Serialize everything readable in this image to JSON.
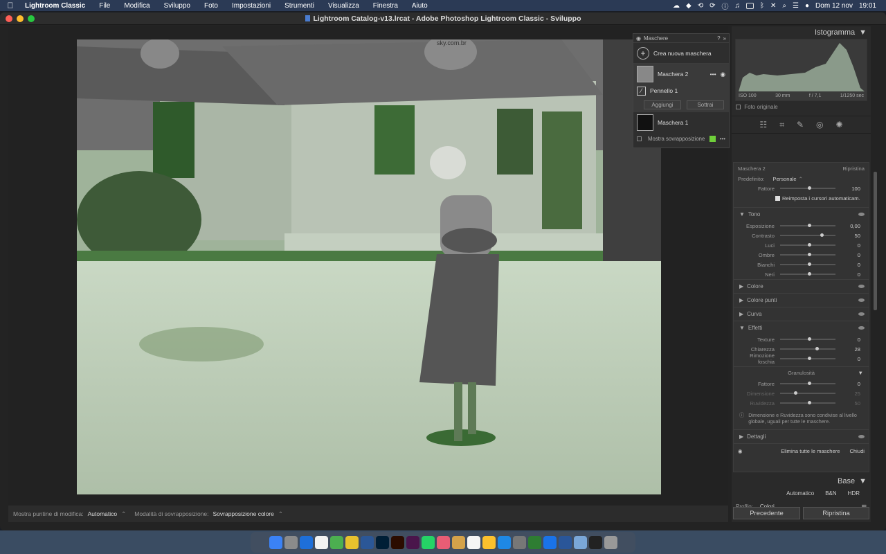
{
  "menubar": {
    "app": "Lightroom Classic",
    "items": [
      "File",
      "Modifica",
      "Sviluppo",
      "Foto",
      "Impostazioni",
      "Strumenti",
      "Visualizza",
      "Finestra",
      "Aiuto"
    ],
    "date": "Dom 12 nov",
    "time": "19:01"
  },
  "window": {
    "title": "Lightroom Catalog-v13.lrcat - Adobe Photoshop Lightroom Classic - Sviluppo"
  },
  "photo_overlay": {
    "color": "#7ed36a"
  },
  "masks_panel": {
    "title": "Maschere",
    "create_label": "Crea nuova maschera",
    "mask2": "Maschera 2",
    "brush": "Pennello 1",
    "add": "Aggiungi",
    "subtract": "Sottrai",
    "mask1": "Maschera 1",
    "show_overlay": "Mostra sovrapposizione",
    "overlay_color": "#6fcf3a"
  },
  "histogram": {
    "title": "Istogramma",
    "iso": "ISO 100",
    "focal": "30 mm",
    "aperture": "f / 7,1",
    "shutter": "1/1250 sec",
    "original_photo": "Foto originale"
  },
  "mask_settings": {
    "mask_name": "Maschera 2",
    "reset": "Ripristina",
    "preset_label": "Predefinito:",
    "preset_value": "Personale",
    "amount_label": "Fattore",
    "amount_value": "100",
    "auto_reset": "Reimposta i cursori automaticam.",
    "tone_header": "Tono",
    "tone": [
      {
        "label": "Esposizione",
        "value": "0,00",
        "pos": 0.5
      },
      {
        "label": "Contrasto",
        "value": "50",
        "pos": 0.72
      },
      {
        "label": "Luci",
        "value": "0",
        "pos": 0.5
      },
      {
        "label": "Ombre",
        "value": "0",
        "pos": 0.5
      },
      {
        "label": "Bianchi",
        "value": "0",
        "pos": 0.5
      },
      {
        "label": "Neri",
        "value": "0",
        "pos": 0.5
      }
    ],
    "color_header": "Colore",
    "point_color_header": "Colore punti",
    "curve_header": "Curva",
    "effects_header": "Effetti",
    "effects": [
      {
        "label": "Texture",
        "value": "0",
        "pos": 0.5
      },
      {
        "label": "Chiarezza",
        "value": "28",
        "pos": 0.64
      },
      {
        "label": "Rimozione foschia",
        "value": "0",
        "pos": 0.5
      }
    ],
    "grain_header": "Granulosità",
    "grain": [
      {
        "label": "Fattore",
        "value": "0",
        "pos": 0.5
      },
      {
        "label": "Dimensione",
        "value": "25",
        "pos": 0.25
      },
      {
        "label": "Ruvidezza",
        "value": "50",
        "pos": 0.5
      }
    ],
    "grain_note": "Dimensione e Ruvidezza sono condivise al livello globale, uguali per tutte le maschere.",
    "details_header": "Dettagli",
    "delete_all": "Elimina tutte le maschere",
    "close": "Chiudi"
  },
  "base_panel": {
    "title": "Base",
    "auto": "Automatico",
    "bw": "B&N",
    "hdr": "HDR",
    "profile_label": "Profilo:",
    "profile_value": "Colori"
  },
  "bottom_buttons": {
    "previous": "Precedente",
    "reset": "Ripristina"
  },
  "toolbar": {
    "show_pins_label": "Mostra puntine di modifica:",
    "show_pins_value": "Automatico",
    "overlay_mode_label": "Modalità di sovrapposizione:",
    "overlay_mode_value": "Sovrapposizione colore"
  },
  "photo_text": {
    "sign": "sky.com.br"
  },
  "dock": [
    "Finder",
    "Launchpad",
    "Outlook",
    "Calendario",
    "Mappe",
    "Chrome",
    "Lrc",
    "Ps",
    "Br",
    "Slack",
    "WhatsApp",
    "Foto",
    "Note",
    "Promemoria",
    "Notes",
    "App Store",
    "Impostazioni",
    "D",
    "Drive",
    "Docs",
    "Cartella",
    "Terminale",
    "Cestino"
  ]
}
